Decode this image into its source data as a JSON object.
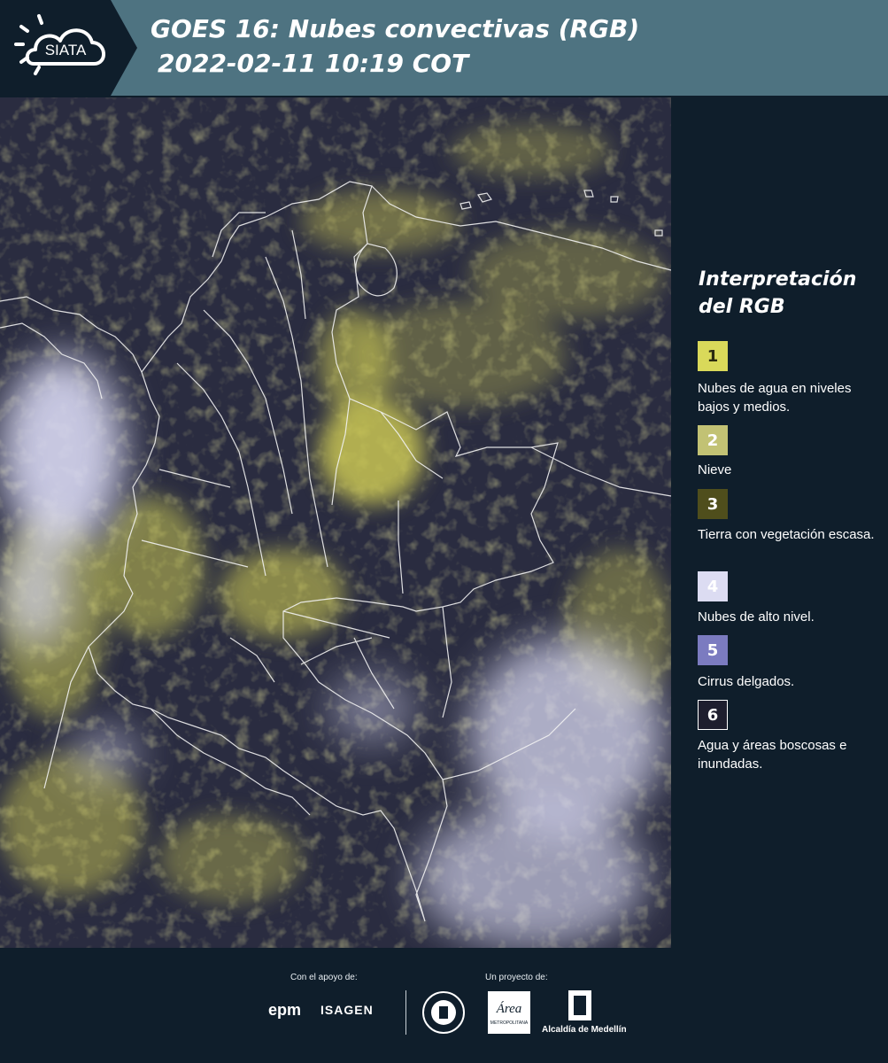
{
  "header": {
    "logo_text": "SIATA",
    "title_line1": "GOES 16: Nubes convectivas (RGB)",
    "title_line2": "2022-02-11 10:19 COT"
  },
  "legend": {
    "title": "Interpretación del RGB",
    "items": [
      {
        "number": "1",
        "color": "#d9d95a",
        "text_color": "#2a2a10",
        "description": "Nubes de agua en niveles bajos y medios."
      },
      {
        "number": "2",
        "color": "#c2c274",
        "text_color": "#ffffff",
        "description": "Nieve"
      },
      {
        "number": "3",
        "color": "#4f4e1c",
        "text_color": "#ffffff",
        "description": "Tierra con vegetación escasa."
      },
      {
        "number": "4",
        "color": "#dcdcf2",
        "text_color": "#ffffff",
        "description": "Nubes de alto nivel."
      },
      {
        "number": "5",
        "color": "#7b7bc0",
        "text_color": "#ffffff",
        "description": "Cirrus delgados."
      },
      {
        "number": "6",
        "color": "#1e1e2e",
        "text_color": "#ffffff",
        "description": "Agua y áreas boscosas e inundadas."
      }
    ]
  },
  "footer": {
    "support_label": "Con el apoyo de:",
    "project_label": "Un proyecto de:",
    "sponsors": [
      "epm",
      "ISAGEN"
    ],
    "partners": [
      "Área Metropolitana Valle de Aburrá",
      "Alcaldía de Medellín"
    ],
    "epm_text": "epm",
    "isagen_text": "ISAGEN",
    "alcaldia_text": "Alcaldía de Medellín"
  },
  "map": {
    "type": "satellite RGB composite",
    "colors": {
      "background": "#22243a",
      "low_cloud": "#c9c653",
      "high_cloud": "#d8d8f2",
      "borders": "#f2f2f2"
    }
  }
}
